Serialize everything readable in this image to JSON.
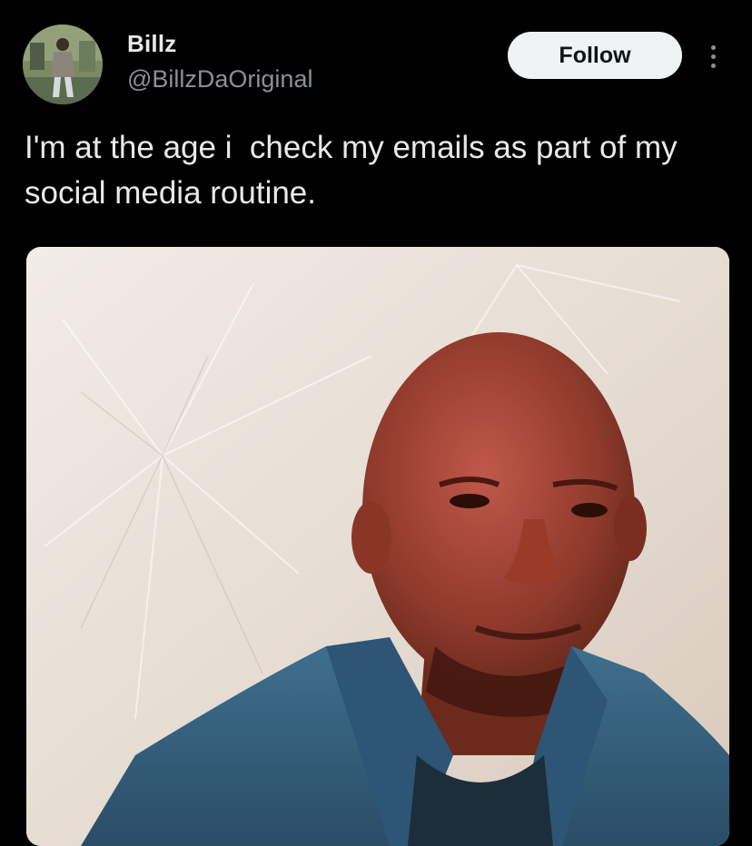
{
  "post": {
    "author": {
      "display_name": "Billz",
      "handle": "@BillzDaOriginal",
      "avatar_icon": "profile-photo-avatar"
    },
    "follow_label": "Follow",
    "more_icon": "more-vertical-icon",
    "text": "I'm at the age i  check my emails as part of my social media routine.",
    "media": {
      "kind": "photo",
      "icon": "photo-media"
    }
  },
  "colors": {
    "background": "#000000",
    "primary_text": "#e7e9ea",
    "secondary_text": "#8b9096",
    "follow_button_bg": "#eff3f4",
    "follow_button_text": "#0f1419"
  }
}
